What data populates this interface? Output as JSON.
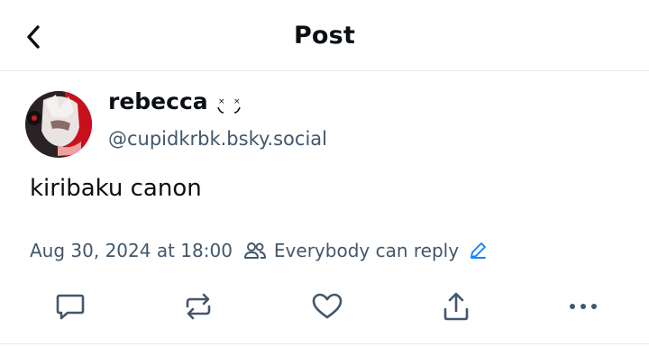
{
  "header": {
    "title": "Post"
  },
  "post": {
    "display_name": "rebecca",
    "name_decoration": "⸼͡˘͡⸼",
    "handle": "@cupidkrbk.bsky.social",
    "text": "kiribaku canon",
    "timestamp": "Aug 30, 2024 at 18:00",
    "reply_setting": "Everybody can reply"
  },
  "icons": {
    "back": "chevron-left-icon",
    "reply": "speech-bubble-icon",
    "repost": "repost-arrows-icon",
    "like": "heart-icon",
    "share": "share-upload-icon",
    "more": "ellipsis-icon",
    "people": "people-icon",
    "edit": "pencil-icon"
  },
  "colors": {
    "text": "#0b0f14",
    "muted": "#42576c",
    "accent": "#1083fe",
    "divider": "#e6e9ee"
  }
}
